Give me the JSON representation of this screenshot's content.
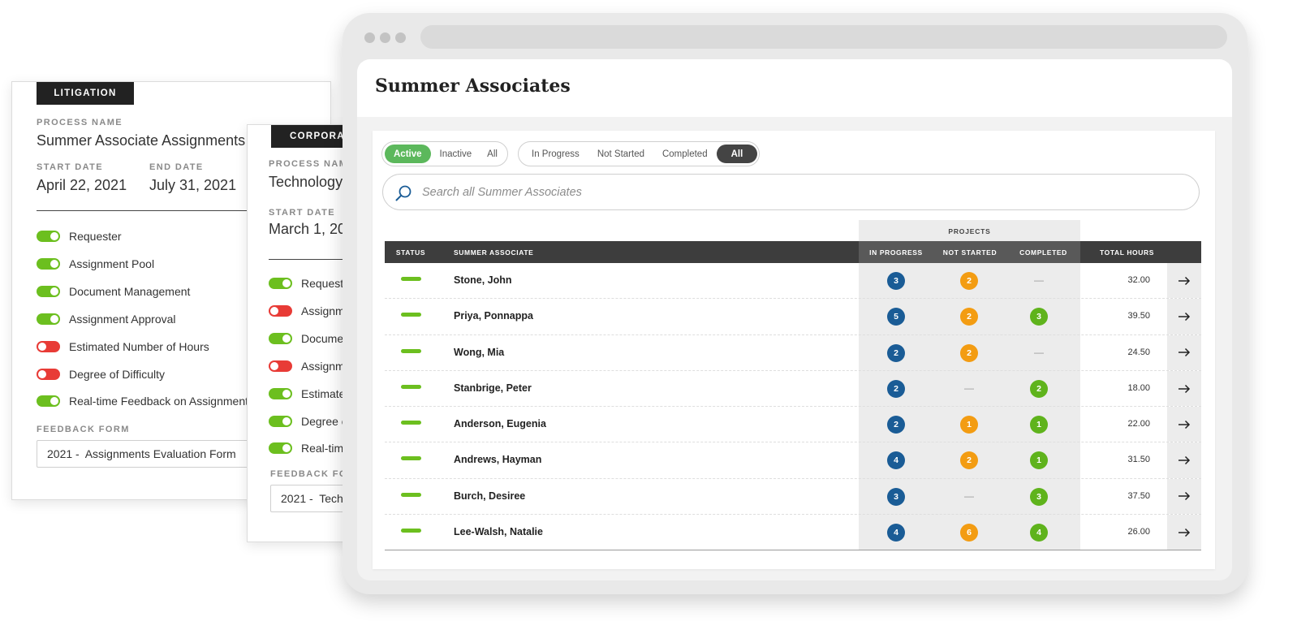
{
  "cards": [
    {
      "tag": "LITIGATION",
      "process_label": "PROCESS NAME",
      "process_name": "Summer Associate Assignments",
      "start_label": "START DATE",
      "start_date": "April 22, 2021",
      "end_label": "END DATE",
      "end_date": "July 31, 2021",
      "toggles": [
        {
          "label": "Requester",
          "on": true
        },
        {
          "label": "Assignment Pool",
          "on": true
        },
        {
          "label": "Document Management",
          "on": true
        },
        {
          "label": "Assignment Approval",
          "on": true
        },
        {
          "label": "Estimated Number of Hours",
          "on": false
        },
        {
          "label": "Degree of Difficulty",
          "on": false
        },
        {
          "label": "Real-time Feedback on Assignments",
          "on": true
        }
      ],
      "feedback_label": "FEEDBACK FORM",
      "feedback_value": "2021 -  Assignments Evaluation Form"
    },
    {
      "tag": "CORPORATE",
      "process_label": "PROCESS NAME",
      "process_name": "Technology",
      "start_label": "START DATE",
      "start_date": "March 1, 20",
      "toggles": [
        {
          "label": "Requeste",
          "on": true
        },
        {
          "label": "Assignm",
          "on": false
        },
        {
          "label": "Docume",
          "on": true
        },
        {
          "label": "Assignm",
          "on": false
        },
        {
          "label": "Estimate",
          "on": true
        },
        {
          "label": "Degree c",
          "on": true
        },
        {
          "label": "Real-tim",
          "on": true
        }
      ],
      "feedback_label": "FEEDBACK FORM",
      "feedback_value": "2021 -  Tech"
    }
  ],
  "page": {
    "title": "Summer Associates",
    "status_filter": [
      "Active",
      "Inactive",
      "All"
    ],
    "status_selected": 0,
    "progress_filter": [
      "In Progress",
      "Not Started",
      "Completed",
      "All"
    ],
    "progress_selected": 3,
    "search_placeholder": "Search all Summer Associates"
  },
  "table": {
    "projects_header": "PROJECTS",
    "columns": {
      "status": "STATUS",
      "associate": "SUMMER ASSOCIATE",
      "in_progress": "IN PROGRESS",
      "not_started": "NOT STARTED",
      "completed": "COMPLETED",
      "total_hours": "TOTAL HOURS"
    },
    "empty_mark": "—",
    "arrow": "→",
    "rows": [
      {
        "name": "Stone, John",
        "in_progress": "3",
        "not_started": "2",
        "completed": "",
        "hours": "32.00"
      },
      {
        "name": "Priya, Ponnappa",
        "in_progress": "5",
        "not_started": "2",
        "completed": "3",
        "hours": "39.50"
      },
      {
        "name": "Wong, Mia",
        "in_progress": "2",
        "not_started": "2",
        "completed": "",
        "hours": "24.50"
      },
      {
        "name": "Stanbrige, Peter",
        "in_progress": "2",
        "not_started": "",
        "completed": "2",
        "hours": "18.00"
      },
      {
        "name": "Anderson, Eugenia",
        "in_progress": "2",
        "not_started": "1",
        "completed": "1",
        "hours": "22.00"
      },
      {
        "name": "Andrews, Hayman",
        "in_progress": "4",
        "not_started": "2",
        "completed": "1",
        "hours": "31.50"
      },
      {
        "name": "Burch, Desiree",
        "in_progress": "3",
        "not_started": "",
        "completed": "3",
        "hours": "37.50"
      },
      {
        "name": "Lee-Walsh, Natalie",
        "in_progress": "4",
        "not_started": "6",
        "completed": "4",
        "hours": "26.00"
      }
    ]
  },
  "colors": {
    "toggle_on": "#6cbf1f",
    "toggle_off": "#e83b36",
    "in_progress": "#1a5c96",
    "not_started": "#f39c12",
    "completed": "#5fb31c",
    "active_filter": "#5cb85c"
  },
  "icons": {
    "search": "search-icon",
    "row_action": "arrow-right-icon"
  }
}
